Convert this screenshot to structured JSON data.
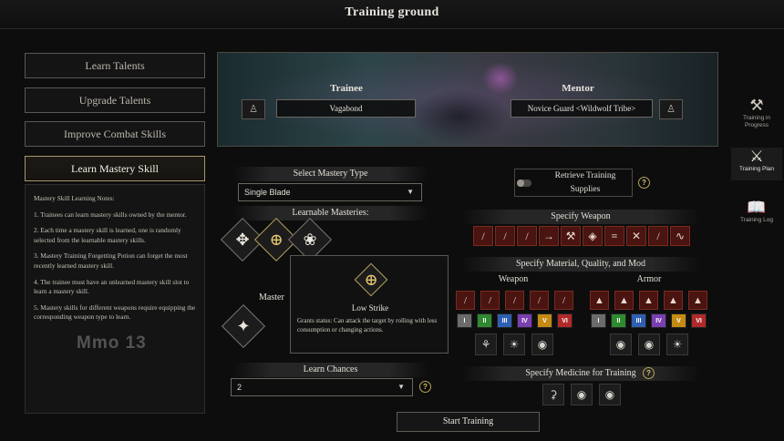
{
  "window": {
    "title": "Training ground"
  },
  "left_menu": [
    {
      "label": "Learn Talents"
    },
    {
      "label": "Upgrade Talents"
    },
    {
      "label": "Improve Combat Skills"
    },
    {
      "label": "Learn Mastery Skill",
      "active": true
    }
  ],
  "notes": {
    "title": "Mastery Skill Learning Notes:",
    "items": [
      "1. Trainees can learn mastery skills owned by the mentor.",
      "2. Each time a mastery skill is learned, one is randomly selected from the learnable mastery skills.",
      "3. Mastery Training Forgetting Potion can forget the most recently learned mastery skill.",
      "4. The trainee must have an unlearned mastery skill slot to learn a mastery skill.",
      "5. Mastery skills for different weapons require equipping the corresponding weapon type to learn."
    ],
    "watermark": "Mmo 13"
  },
  "banner": {
    "trainee_label": "Trainee",
    "trainee_name": "Vagabond",
    "mentor_label": "Mentor",
    "mentor_name": "Novice Guard <Wildwolf Tribe>"
  },
  "mastery": {
    "select_type_label": "Select Mastery Type",
    "selected_type": "Single Blade",
    "learnable_label": "Learnable Masteries:",
    "learned_label_partial": "Master",
    "learn_chances_label": "Learn Chances",
    "learn_chances_value": "2",
    "help_icon": "?"
  },
  "tooltip": {
    "skill_name": "Low Strike",
    "description": "Grants status: Can attack the target by rolling with less consumption or changing actions."
  },
  "right": {
    "retrieve_label_line1": "Retrieve Training",
    "retrieve_label_line2": "Supplies",
    "specify_weapon_label": "Specify Weapon",
    "specify_material_label": "Specify Material, Quality, and Mod",
    "weapon_label": "Weapon",
    "armor_label": "Armor",
    "specify_medicine_label": "Specify Medicine for Training",
    "weapon_icons": [
      "sword-icon",
      "spear-icon",
      "dagger-icon",
      "bow-icon",
      "axe-icon",
      "shield-icon",
      "fan-icon",
      "dual-blades-icon",
      "staff-icon",
      "whip-icon"
    ],
    "weapon_glyphs": [
      "/",
      "/",
      "/",
      "→",
      "⚒",
      "◈",
      "≡",
      "✕",
      "/",
      "∿"
    ],
    "quality_tiers": [
      {
        "label": "I",
        "color": "#6b6b6b"
      },
      {
        "label": "II",
        "color": "#2f8a2f"
      },
      {
        "label": "III",
        "color": "#2f5fb0"
      },
      {
        "label": "IV",
        "color": "#7a3fb0"
      },
      {
        "label": "V",
        "color": "#c48a12"
      },
      {
        "label": "VI",
        "color": "#b02a2a"
      }
    ]
  },
  "buttons": {
    "start_training": "Start Training"
  },
  "sidebar": [
    {
      "label": "Training in Progress",
      "icon": "hammer-icon"
    },
    {
      "label": "Training Plan",
      "icon": "crossed-swords-icon"
    },
    {
      "label": "Training Log",
      "icon": "book-icon"
    }
  ]
}
